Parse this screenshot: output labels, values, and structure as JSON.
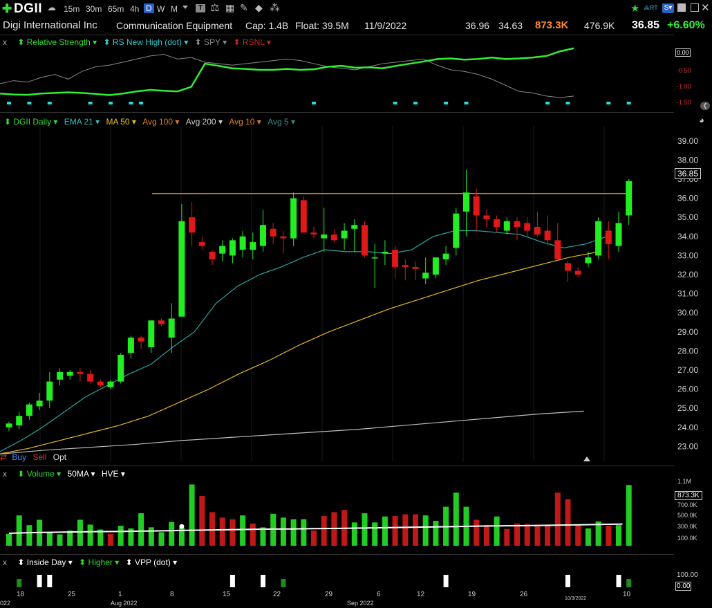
{
  "header": {
    "ticker": "DGII",
    "timeframes": [
      "15m",
      "30m",
      "65m",
      "4h",
      "D",
      "W",
      "M"
    ],
    "active_timeframe": "D",
    "company": "Digi International Inc",
    "industry": "Communication Equipment",
    "cap": "Cap: 1.4B",
    "float": "Float: 39.5M",
    "date": "11/9/2022",
    "high": "36.96",
    "low": "34.63",
    "volume": "873.3K",
    "avg_volume": "476.9K",
    "last": "36.85",
    "change": "+6.60%",
    "rt_label": "RT"
  },
  "rs_pane": {
    "close_label": "x",
    "items": [
      {
        "label": "Relative Strength",
        "color": "#33dd33"
      },
      {
        "label": "RS New High (dot)",
        "color": "#33cccc"
      },
      {
        "label": "SPY",
        "color": "#888888"
      },
      {
        "label": "RSNL",
        "color": "#cc2222"
      }
    ],
    "ticks": [
      "0.00",
      "-0.50",
      "-1.00",
      "-1.50"
    ]
  },
  "price_pane": {
    "items": [
      {
        "label": "DGII Daily",
        "color": "#33dd33"
      },
      {
        "label": "EMA 21",
        "color": "#33bbbb"
      },
      {
        "label": "MA 50",
        "color": "#e8c020"
      },
      {
        "label": "Avg 100",
        "color": "#e08020"
      },
      {
        "label": "Avg 200",
        "color": "#cfcfcf"
      },
      {
        "label": "Avg 10",
        "color": "#e08020"
      },
      {
        "label": "Avg 5",
        "color": "#3a8a8a"
      }
    ],
    "price_tag": "36.85",
    "trade": {
      "buy": "Buy",
      "sell": "Sell",
      "opt": "Opt"
    }
  },
  "volume_pane": {
    "close_label": "x",
    "items": [
      {
        "label": "Volume",
        "color": "#33dd33"
      },
      {
        "label": "50MA",
        "color": "#ffffff"
      },
      {
        "label": "HVE",
        "color": "#ffffff"
      }
    ],
    "volume_tag": "873.3K"
  },
  "signal_pane": {
    "close_label": "x",
    "items": [
      {
        "label": "Inside Day",
        "color": "#ffffff"
      },
      {
        "label": "Higher",
        "color": "#33dd33"
      },
      {
        "label": "VPP (dot)",
        "color": "#ffffff"
      }
    ],
    "ticks": [
      "100.00",
      "0.00"
    ]
  },
  "x_axis": {
    "ticks": [
      "18",
      "25",
      "1",
      "8",
      "15",
      "22",
      "29",
      "6",
      "12",
      "19",
      "26",
      "3",
      "10"
    ],
    "months": [
      "Aug 2022",
      "Sep 2022"
    ],
    "left_year": "022",
    "edge_date": "10/3/2022"
  },
  "chart_data": {
    "type": "candlestick",
    "y_ticks": [
      23,
      24,
      25,
      26,
      27,
      28,
      29,
      30,
      31,
      32,
      33,
      34,
      35,
      36,
      37,
      38,
      39
    ],
    "ylim": [
      22.4,
      39.5
    ],
    "resistance_level": 36.25,
    "candles": [
      [
        24.0,
        24.3,
        23.8,
        24.2
      ],
      [
        24.1,
        24.8,
        23.9,
        24.6
      ],
      [
        24.6,
        25.3,
        24.4,
        25.2
      ],
      [
        25.1,
        25.8,
        24.9,
        25.4
      ],
      [
        25.4,
        26.9,
        25.0,
        26.4
      ],
      [
        26.5,
        27.1,
        26.2,
        26.9
      ],
      [
        26.7,
        27.0,
        26.5,
        26.9
      ],
      [
        26.9,
        27.1,
        26.4,
        26.8
      ],
      [
        26.8,
        27.0,
        26.3,
        26.4
      ],
      [
        26.4,
        26.5,
        26.1,
        26.2
      ],
      [
        26.1,
        26.5,
        26.0,
        26.4
      ],
      [
        26.4,
        27.9,
        26.3,
        27.8
      ],
      [
        27.9,
        28.8,
        27.6,
        28.7
      ],
      [
        28.7,
        28.8,
        28.1,
        28.5
      ],
      [
        28.2,
        29.6,
        27.9,
        29.6
      ],
      [
        29.6,
        29.7,
        29.3,
        29.4
      ],
      [
        28.7,
        30.5,
        27.9,
        29.7
      ],
      [
        29.8,
        35.7,
        31.2,
        34.8
      ],
      [
        35.0,
        35.8,
        33.5,
        34.2
      ],
      [
        33.7,
        34.0,
        33.3,
        33.5
      ],
      [
        33.2,
        33.3,
        32.5,
        32.8
      ],
      [
        33.1,
        33.8,
        32.7,
        33.5
      ],
      [
        33.0,
        33.9,
        32.6,
        33.8
      ],
      [
        33.3,
        34.3,
        32.9,
        34.0
      ],
      [
        33.3,
        34.2,
        32.8,
        33.7
      ],
      [
        33.5,
        35.4,
        33.2,
        34.6
      ],
      [
        34.4,
        34.7,
        33.6,
        34.0
      ],
      [
        34.0,
        34.3,
        33.1,
        33.9
      ],
      [
        33.9,
        36.3,
        33.5,
        36.0
      ],
      [
        35.9,
        36.1,
        34.2,
        34.2
      ],
      [
        34.2,
        34.5,
        33.9,
        34.1
      ],
      [
        33.9,
        35.5,
        33.2,
        34.1
      ],
      [
        34.1,
        34.4,
        33.7,
        33.8
      ],
      [
        33.9,
        34.7,
        33.3,
        34.3
      ],
      [
        34.4,
        34.9,
        33.2,
        34.6
      ],
      [
        34.6,
        34.8,
        32.9,
        33.0
      ],
      [
        32.9,
        33.6,
        31.3,
        32.9
      ],
      [
        33.1,
        33.8,
        32.5,
        33.2
      ],
      [
        33.3,
        33.5,
        31.8,
        32.4
      ],
      [
        32.5,
        32.8,
        31.7,
        32.4
      ],
      [
        32.4,
        32.7,
        31.7,
        32.3
      ],
      [
        31.8,
        32.9,
        31.5,
        32.1
      ],
      [
        32.0,
        32.9,
        31.8,
        32.9
      ],
      [
        32.8,
        33.5,
        32.5,
        33.1
      ],
      [
        33.4,
        35.5,
        33.0,
        35.2
      ],
      [
        35.3,
        37.5,
        34.0,
        36.3
      ],
      [
        36.1,
        36.5,
        34.2,
        35.1
      ],
      [
        35.1,
        35.4,
        34.5,
        34.9
      ],
      [
        34.9,
        35.1,
        34.2,
        34.5
      ],
      [
        34.3,
        35.0,
        34.1,
        34.8
      ],
      [
        34.8,
        35.0,
        33.8,
        34.5
      ],
      [
        34.7,
        35.0,
        34.0,
        34.3
      ],
      [
        34.5,
        35.3,
        34.0,
        34.1
      ],
      [
        34.3,
        35.1,
        33.5,
        33.8
      ],
      [
        33.8,
        34.7,
        32.8,
        32.8
      ],
      [
        32.6,
        32.7,
        31.6,
        32.2
      ],
      [
        32.2,
        32.4,
        31.9,
        32.0
      ],
      [
        32.6,
        33.2,
        32.4,
        32.9
      ],
      [
        33.0,
        35.0,
        32.8,
        34.8
      ],
      [
        34.3,
        34.8,
        32.8,
        33.6
      ],
      [
        33.5,
        35.3,
        33.2,
        34.7
      ],
      [
        35.1,
        37.0,
        34.6,
        36.9
      ]
    ],
    "ema21": [
      22.7,
      23.3,
      24.0,
      24.8,
      25.6,
      26.2,
      26.8,
      27.3,
      28.2,
      29.0,
      30.5,
      31.4,
      32.0,
      32.4,
      32.9,
      33.3,
      33.2,
      33.2,
      33.1,
      33.3,
      34.0,
      34.3,
      34.3,
      34.2,
      34.1,
      33.7,
      33.4,
      33.6,
      34.0
    ],
    "ma50": [
      22.6,
      22.9,
      23.3,
      23.7,
      24.1,
      24.6,
      25.3,
      26.0,
      26.8,
      27.5,
      28.3,
      29.0,
      29.6,
      30.2,
      30.7,
      31.2,
      31.7,
      32.1,
      32.5,
      32.9,
      33.2
    ],
    "avg200": [
      22.6,
      22.8,
      22.95,
      23.1,
      23.3,
      23.45,
      23.6,
      23.75,
      23.9,
      24.1,
      24.3,
      24.5,
      24.7,
      24.85
    ],
    "volume": {
      "ylim": [
        0,
        1200
      ],
      "y_ticks": [
        "1.1M",
        "700.0K",
        "500.0K",
        "300.0K",
        "100.0K"
      ],
      "bars": [
        220,
        560,
        380,
        480,
        250,
        210,
        280,
        480,
        390,
        300,
        220,
        370,
        320,
        600,
        340,
        250,
        440,
        330,
        1130,
        920,
        620,
        520,
        490,
        560,
        410,
        340,
        590,
        520,
        490,
        490,
        280,
        550,
        620,
        660,
        430,
        600,
        430,
        540,
        550,
        580,
        580,
        560,
        460,
        720,
        980,
        720,
        480,
        380,
        540,
        310,
        410,
        400,
        390,
        380,
        980,
        860,
        380,
        320,
        450,
        370,
        380,
        1120
      ],
      "up": [
        1,
        1,
        1,
        1,
        1,
        1,
        1,
        1,
        1,
        1,
        0,
        1,
        1,
        1,
        1,
        1,
        1,
        1,
        1,
        0,
        0,
        0,
        0,
        1,
        0,
        1,
        1,
        1,
        1,
        1,
        0,
        0,
        0,
        0,
        1,
        1,
        1,
        1,
        0,
        0,
        0,
        1,
        1,
        1,
        1,
        1,
        0,
        0,
        1,
        0,
        0,
        0,
        0,
        0,
        0,
        0,
        0,
        1,
        1,
        0,
        1,
        1
      ],
      "ma50": [
        230,
        240,
        245,
        250,
        255,
        260,
        262,
        265,
        270,
        275,
        280,
        285,
        290,
        295,
        300,
        305,
        308,
        310,
        315,
        318,
        320,
        325,
        330,
        335,
        340,
        345,
        350,
        355,
        360,
        365,
        368,
        370,
        375,
        380,
        385,
        390,
        395,
        400
      ]
    },
    "rs": {
      "ylim": [
        -1.75,
        0.0
      ],
      "rs_line": [
        -1.42,
        -1.45,
        -1.46,
        -1.42,
        -1.4,
        -1.38,
        -1.4,
        -1.43,
        -1.47,
        -1.42,
        -1.35,
        -1.3,
        -1.33,
        -1.35,
        -1.2,
        -0.45,
        -0.52,
        -0.6,
        -0.62,
        -0.65,
        -0.65,
        -0.62,
        -0.65,
        -0.63,
        -0.55,
        -0.52,
        -0.58,
        -0.57,
        -0.6,
        -0.52,
        -0.45,
        -0.38,
        -0.3,
        -0.28,
        -0.32,
        -0.3,
        -0.25,
        -0.3,
        -0.28,
        -0.25,
        -0.2,
        -0.05,
        0.05
      ],
      "spy_line": [
        -1.1,
        -1.0,
        -1.05,
        -0.9,
        -0.8,
        -0.95,
        -0.7,
        -0.55,
        -0.5,
        -0.4,
        -0.3,
        -0.2,
        -0.15,
        -0.3,
        -0.25,
        -0.4,
        -0.45,
        -0.5,
        -0.45,
        -0.4,
        -0.35,
        -0.3,
        -0.35,
        -0.45,
        -0.55,
        -0.6,
        -0.65,
        -0.55,
        -0.45,
        -0.4,
        -0.35,
        -0.3,
        -0.5,
        -0.65,
        -0.7,
        -0.8,
        -0.95,
        -1.15,
        -1.35,
        -1.4,
        -1.5,
        -1.55,
        -1.5
      ],
      "new_high_dots": [
        0,
        2,
        4,
        8,
        10,
        12,
        13,
        30,
        38,
        40,
        43,
        45,
        53,
        55,
        59,
        61
      ]
    },
    "signals": {
      "inside_day": [
        3,
        4,
        22,
        25,
        43,
        55,
        60
      ],
      "higher": [
        1,
        27,
        61
      ]
    }
  }
}
